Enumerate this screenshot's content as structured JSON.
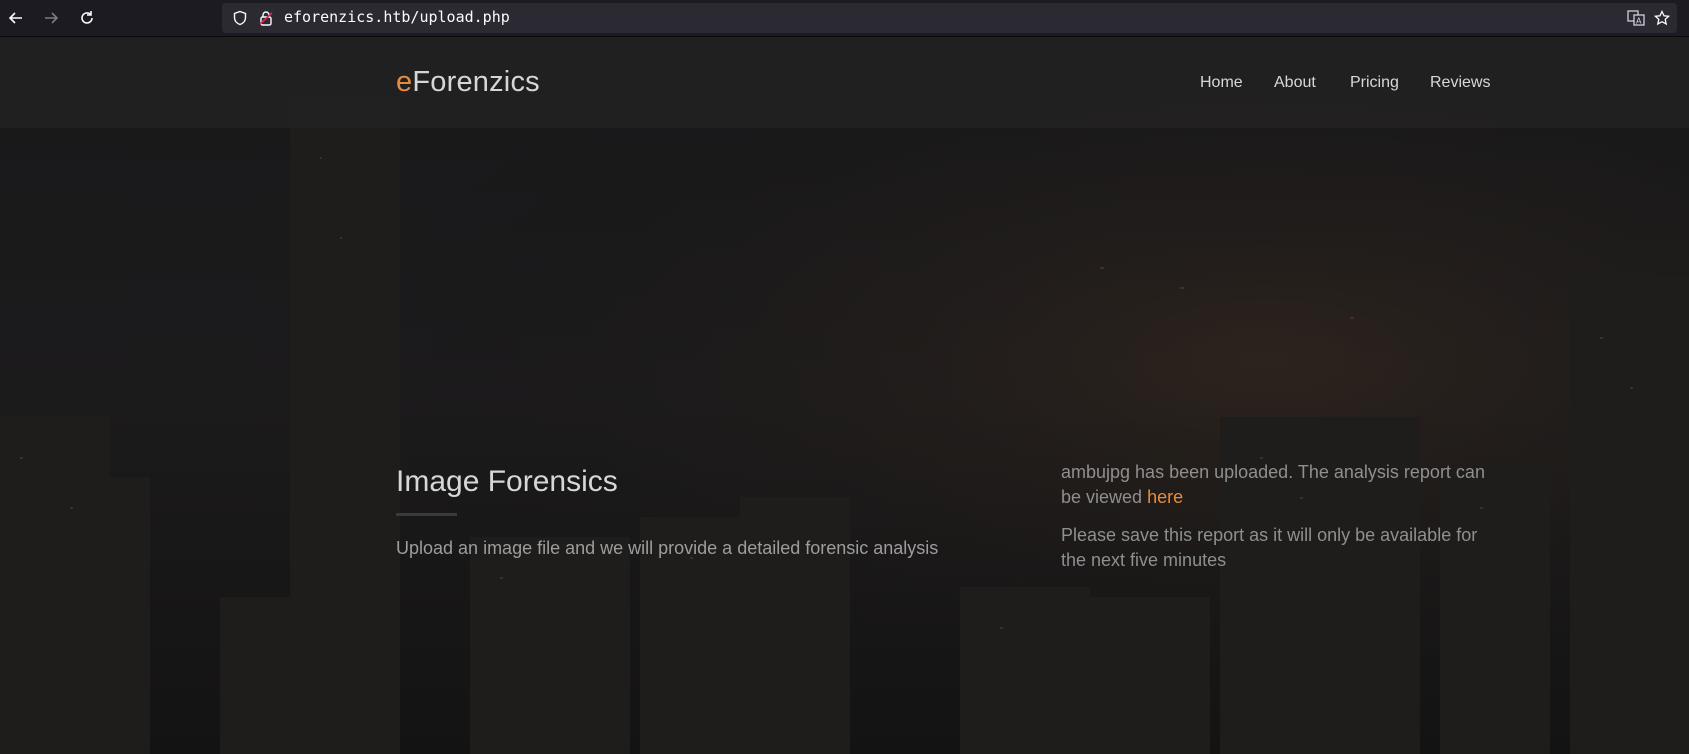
{
  "browser": {
    "url": "eforenzics.htb/upload.php",
    "icons": [
      "back-arrow-icon",
      "forward-arrow-icon",
      "reload-icon",
      "shield-icon",
      "lock-icon",
      "translate-icon",
      "bookmark-star-icon"
    ]
  },
  "site": {
    "brand_accent": "e",
    "brand_rest": "Forenzics",
    "nav": [
      "Home",
      "About",
      "Pricing",
      "Reviews"
    ]
  },
  "hero": {
    "title": "Image Forensics",
    "subtitle": "Upload an image file and we will provide a detailed forensic analysis"
  },
  "result": {
    "uploaded_prefix": "ambujpg has been uploaded. The analysis report can be viewed ",
    "link_text": "here",
    "note": "Please save this report as it will only be available for the next five minutes"
  },
  "colors": {
    "accent": "#e98b3d",
    "header_bg": "#222121",
    "text": "#d7d7d7"
  }
}
